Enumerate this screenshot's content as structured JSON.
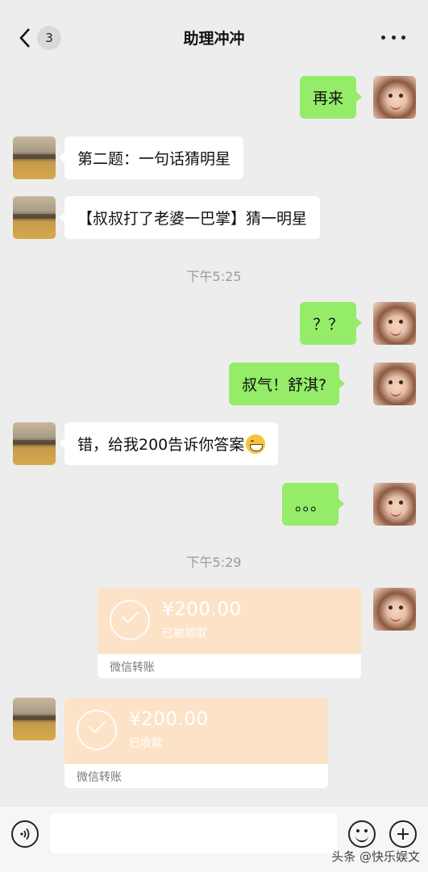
{
  "header": {
    "unread_count": "3",
    "title": "助理冲冲"
  },
  "messages": {
    "m1": "再来",
    "m2": "第二题：一句话猜明星",
    "m3": "【叔叔打了老婆一巴掌】猜一明星",
    "ts1": "下午5:25",
    "m4": "？？",
    "m5": "叔气！舒淇?",
    "m6": "错，给我200告诉你答案",
    "m7": "。。。",
    "ts2": "下午5:29"
  },
  "transfers": {
    "sent": {
      "amount": "¥200.00",
      "status": "已被领取",
      "label": "微信转账"
    },
    "received": {
      "amount": "¥200.00",
      "status": "已收款",
      "label": "微信转账"
    }
  },
  "input": {
    "value": ""
  },
  "watermark": "头条 @快乐娱文",
  "colors": {
    "background": "#ededed",
    "my_bubble": "#95ec69",
    "their_bubble": "#ffffff",
    "transfer": "#fce3c8"
  }
}
